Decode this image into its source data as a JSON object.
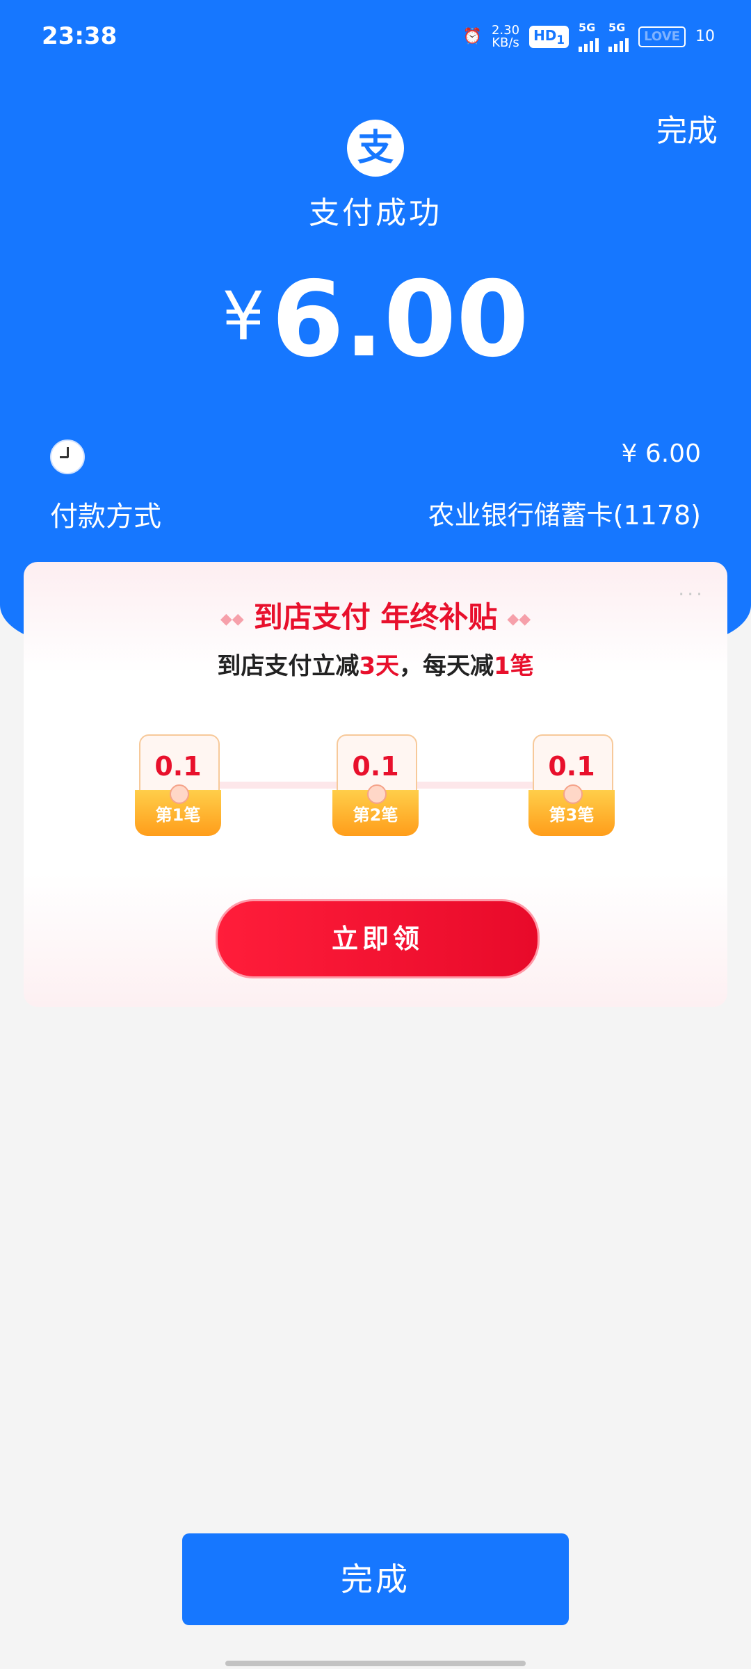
{
  "status_bar": {
    "time": "23:38",
    "net_speed": "2.30",
    "net_unit": "KB/s",
    "hd": "HD",
    "hd_sub": "1",
    "sim1": "5G",
    "sim2": "5G",
    "battery_label": "LOVE",
    "battery_level": "10"
  },
  "header": {
    "done_label": "完成",
    "logo_char": "支",
    "status_text": "支付成功",
    "currency": "¥",
    "amount": "6.00"
  },
  "details": {
    "amount_row": "¥ 6.00",
    "payment_label": "付款方式",
    "payment_value": "农业银行储蓄卡(1178)"
  },
  "promo": {
    "title": "到店支付 年终补贴",
    "subtitle_part1": "到店支付立减",
    "subtitle_days": "3天",
    "subtitle_part2": "，每天减",
    "subtitle_count": "1笔",
    "more_label": "···",
    "coupons": [
      {
        "value": "0.1",
        "label": "第1笔"
      },
      {
        "value": "0.1",
        "label": "第2笔"
      },
      {
        "value": "0.1",
        "label": "第3笔"
      }
    ],
    "claim_label": "立即领"
  },
  "footer": {
    "done_label": "完成"
  },
  "colors": {
    "primary": "#1677ff",
    "promo_red": "#e8102c",
    "background": "#f4f4f4"
  }
}
